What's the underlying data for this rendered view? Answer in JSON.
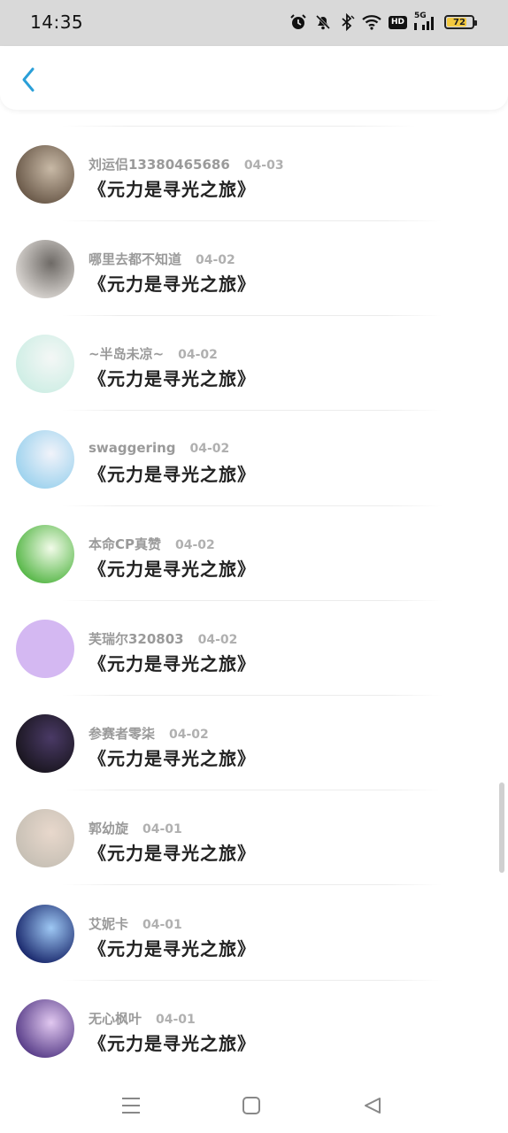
{
  "status_bar": {
    "time": "14:35",
    "network": "5G",
    "hd_label": "HD",
    "battery": "72",
    "icons": [
      "alarm-icon",
      "mute-icon",
      "bluetooth-icon",
      "wifi-icon",
      "hd-icon",
      "signal-icon",
      "battery-icon"
    ]
  },
  "header": {
    "back_icon": "chevron-left-icon",
    "accent_color": "#2a9fd8"
  },
  "comments": [
    {
      "user": "刘运侣13380465686",
      "date": "04-03",
      "message": "《元力是寻光之旅》",
      "avatar_colors": [
        "#6b5a4a",
        "#c8b9a6"
      ]
    },
    {
      "user": "哪里去都不知道",
      "date": "04-02",
      "message": "《元力是寻光之旅》",
      "avatar_colors": [
        "#d8d4d0",
        "#6e6a66"
      ]
    },
    {
      "user": "~半岛未凉~",
      "date": "04-02",
      "message": "《元力是寻光之旅》",
      "avatar_colors": [
        "#cfeee5",
        "#f4f7f6"
      ]
    },
    {
      "user": "swaggering",
      "date": "04-02",
      "message": "《元力是寻光之旅》",
      "avatar_colors": [
        "#9fd3ee",
        "#f1f3fa"
      ]
    },
    {
      "user": "本命CP真赞",
      "date": "04-02",
      "message": "《元力是寻光之旅》",
      "avatar_colors": [
        "#59b84a",
        "#f2fbe9"
      ]
    },
    {
      "user": "芙瑞尔320803",
      "date": "04-02",
      "message": "《元力是寻光之旅》",
      "avatar_colors": [
        "#d4b8f2",
        "#d4b8f2"
      ]
    },
    {
      "user": "参赛者零柒",
      "date": "04-02",
      "message": "《元力是寻光之旅》",
      "avatar_colors": [
        "#1a1620",
        "#4a3a66"
      ]
    },
    {
      "user": "郭幼旋",
      "date": "04-01",
      "message": "《元力是寻光之旅》",
      "avatar_colors": [
        "#c7c0b5",
        "#e8d8cc"
      ]
    },
    {
      "user": "艾妮卡",
      "date": "04-01",
      "message": "《元力是寻光之旅》",
      "avatar_colors": [
        "#1b2a6e",
        "#9ec8f4"
      ]
    },
    {
      "user": "无心枫叶",
      "date": "04-01",
      "message": "《元力是寻光之旅》",
      "avatar_colors": [
        "#5a3f8a",
        "#e1c8f0"
      ]
    }
  ],
  "nav_bar": {
    "icons": [
      "menu-icon",
      "home-square-icon",
      "back-triangle-icon"
    ]
  }
}
